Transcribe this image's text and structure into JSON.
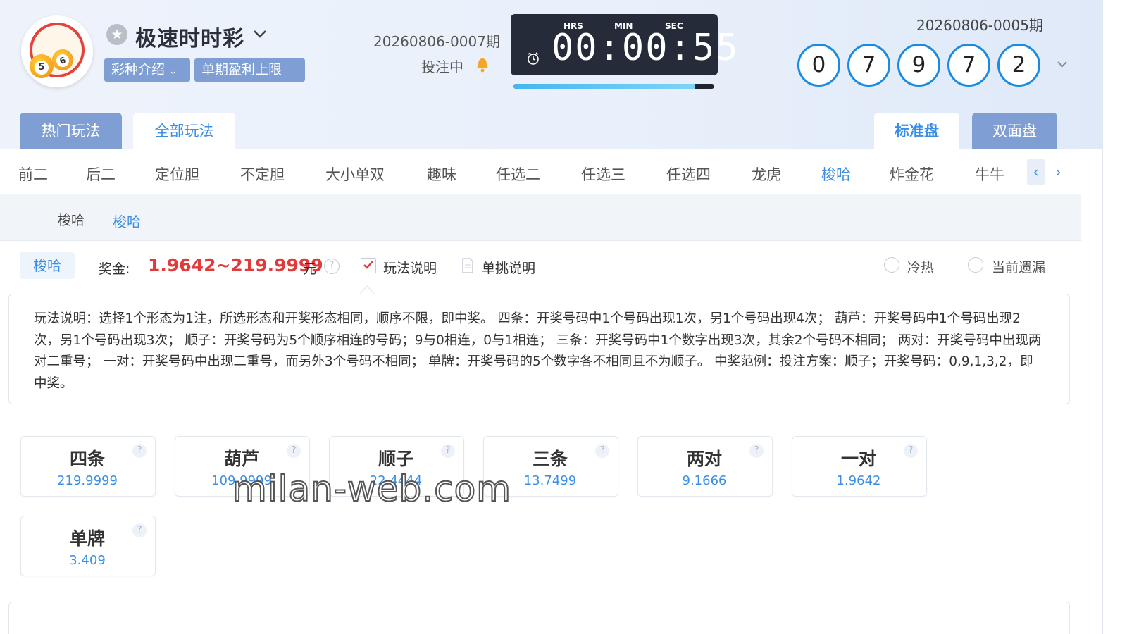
{
  "header": {
    "logo_text": "极速时时彩",
    "logo_balls": [
      "5",
      "6"
    ],
    "game_name": "极速时时彩",
    "intro_button": "彩种介绍",
    "profit_limit_button": "单期盈利上限",
    "current_issue": "20260806-0007期",
    "status": "投注中",
    "timer": {
      "hrs_label": "HRS",
      "min_label": "MIN",
      "sec_label": "SEC",
      "value": "00:00:55",
      "progress": 0.9
    },
    "last_issue": "20260806-0005期",
    "last_numbers": [
      "0",
      "7",
      "9",
      "7",
      "2"
    ]
  },
  "tabs": {
    "hot": "热门玩法",
    "all": "全部玩法",
    "standard": "标准盘",
    "double": "双面盘"
  },
  "categories": [
    "前二",
    "后二",
    "定位胆",
    "不定胆",
    "大小单双",
    "趣味",
    "任选二",
    "任选三",
    "任选四",
    "龙虎",
    "梭哈",
    "炸金花",
    "牛牛"
  ],
  "active_category": "梭哈",
  "nav": {
    "prev": "‹",
    "next": "›"
  },
  "subcategory": {
    "group_label": "梭哈",
    "item": "梭哈"
  },
  "bonus": {
    "pill": "梭哈",
    "label": "奖金:",
    "value": "1.9642~219.9999",
    "unit": "元",
    "help": "?",
    "rules_label": "玩法说明",
    "single_label": "单挑说明",
    "radio_hot_cold": "冷热",
    "radio_missing": "当前遗漏"
  },
  "description": "玩法说明：选择1个形态为1注，所选形态和开奖形态相同，顺序不限，即中奖。 四条：开奖号码中1个号码出现1次，另1个号码出现4次； 葫芦：开奖号码中1个号码出现2次，另1个号码出现3次； 顺子：开奖号码为5个顺序相连的号码；9与0相连，0与1相连； 三条：开奖号码中1个数字出现3次，其余2个号码不相同； 两对：开奖号码中出现两对二重号； 一对：开奖号码中出现二重号，而另外3个号码不相同； 单牌：开奖号码的5个数字各不相同且不为顺子。 中奖范例：投注方案：顺子；开奖号码：0,9,1,3,2，即中奖。",
  "options": [
    {
      "name": "四条",
      "odds": "219.9999"
    },
    {
      "name": "葫芦",
      "odds": "109.9999"
    },
    {
      "name": "顺子",
      "odds": "22.4444"
    },
    {
      "name": "三条",
      "odds": "13.7499"
    },
    {
      "name": "两对",
      "odds": "9.1666"
    },
    {
      "name": "一对",
      "odds": "1.9642"
    },
    {
      "name": "单牌",
      "odds": "3.409"
    }
  ],
  "watermark": "milan-web.com",
  "colors": {
    "accent": "#3a8ee6",
    "tab_bg": "#7f9fd4",
    "bonus_red": "#e03a3a",
    "timer_bg": "#252b38",
    "ball_border": "#1a8be0"
  }
}
